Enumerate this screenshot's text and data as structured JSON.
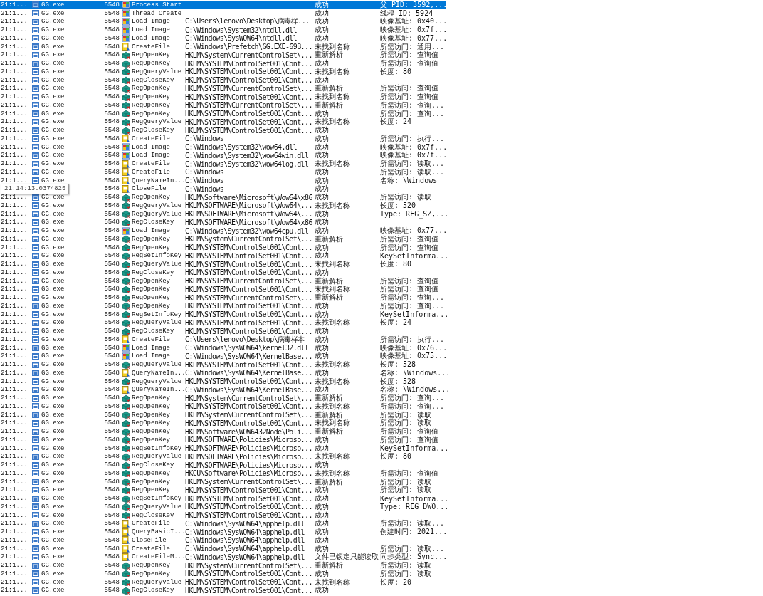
{
  "rows": [
    {
      "time": "21:1...",
      "process": "GG.exe",
      "pid": "5548",
      "kind": "process",
      "operation": "Process Start",
      "result": "成功",
      "detail": "父 PID: 3592,...",
      "selected": true
    },
    {
      "time": "21:1...",
      "process": "GG.exe",
      "pid": "5548",
      "kind": "process",
      "operation": "Thread Create",
      "result": "成功",
      "detail": "线程 ID: 5924",
      "selected": false
    },
    {
      "time": "21:1...",
      "process": "GG.exe",
      "pid": "5548",
      "kind": "process",
      "operation": "Load Image",
      "path": "C:\\Users\\lenovo\\Desktop\\病毒样...",
      "result": "成功",
      "detail": "映像基址: 0x40...",
      "selected": false
    },
    {
      "time": "21:1...",
      "process": "GG.exe",
      "pid": "5548",
      "kind": "process",
      "operation": "Load Image",
      "path": "C:\\Windows\\System32\\ntdll.dll",
      "result": "成功",
      "detail": "映像基址: 0x7f...",
      "selected": false
    },
    {
      "time": "21:1...",
      "process": "GG.exe",
      "pid": "5548",
      "kind": "process",
      "operation": "Load Image",
      "path": "C:\\Windows\\SysWOW64\\ntdll.dll",
      "result": "成功",
      "detail": "映像基址: 0x77...",
      "selected": false
    },
    {
      "time": "21:1...",
      "process": "GG.exe",
      "pid": "5548",
      "kind": "file",
      "operation": "CreateFile",
      "path": "C:\\Windows\\Prefetch\\GG.EXE-69B...",
      "result": "未找到名称",
      "detail": "所需访问: 通用...",
      "selected": false
    },
    {
      "time": "21:1...",
      "process": "GG.exe",
      "pid": "5548",
      "kind": "registry",
      "operation": "RegOpenKey",
      "path": "HKLM\\System\\CurrentControlSet\\...",
      "result": "重新解析",
      "detail": "所需访问: 查询值",
      "selected": false
    },
    {
      "time": "21:1...",
      "process": "GG.exe",
      "pid": "5548",
      "kind": "registry",
      "operation": "RegOpenKey",
      "path": "HKLM\\SYSTEM\\ControlSet001\\Cont...",
      "result": "成功",
      "detail": "所需访问: 查询值",
      "selected": false
    },
    {
      "time": "21:1...",
      "process": "GG.exe",
      "pid": "5548",
      "kind": "registry",
      "operation": "RegQueryValue",
      "path": "HKLM\\SYSTEM\\ControlSet001\\Cont...",
      "result": "未找到名称",
      "detail": "长度: 80",
      "selected": false
    },
    {
      "time": "21:1...",
      "process": "GG.exe",
      "pid": "5548",
      "kind": "registry",
      "operation": "RegCloseKey",
      "path": "HKLM\\SYSTEM\\ControlSet001\\Cont...",
      "result": "成功",
      "selected": false
    },
    {
      "time": "21:1...",
      "process": "GG.exe",
      "pid": "5548",
      "kind": "registry",
      "operation": "RegOpenKey",
      "path": "HKLM\\SYSTEM\\CurrentControlSet\\...",
      "result": "重新解析",
      "detail": "所需访问: 查询值",
      "selected": false
    },
    {
      "time": "21:1...",
      "process": "GG.exe",
      "pid": "5548",
      "kind": "registry",
      "operation": "RegOpenKey",
      "path": "HKLM\\SYSTEM\\ControlSet001\\Cont...",
      "result": "未找到名称",
      "detail": "所需访问: 查询值",
      "selected": false
    },
    {
      "time": "21:1...",
      "process": "GG.exe",
      "pid": "5548",
      "kind": "registry",
      "operation": "RegOpenKey",
      "path": "HKLM\\SYSTEM\\CurrentControlSet\\...",
      "result": "重新解析",
      "detail": "所需访问: 查询...",
      "selected": false
    },
    {
      "time": "21:1...",
      "process": "GG.exe",
      "pid": "5548",
      "kind": "registry",
      "operation": "RegOpenKey",
      "path": "HKLM\\SYSTEM\\ControlSet001\\Cont...",
      "result": "成功",
      "detail": "所需访问: 查询...",
      "selected": false
    },
    {
      "time": "21:1...",
      "process": "GG.exe",
      "pid": "5548",
      "kind": "registry",
      "operation": "RegQueryValue",
      "path": "HKLM\\SYSTEM\\ControlSet001\\Cont...",
      "result": "未找到名称",
      "detail": "长度: 24",
      "selected": false
    },
    {
      "time": "21:1...",
      "process": "GG.exe",
      "pid": "5548",
      "kind": "registry",
      "operation": "RegCloseKey",
      "path": "HKLM\\SYSTEM\\ControlSet001\\Cont...",
      "result": "成功",
      "selected": false
    },
    {
      "time": "21:1...",
      "process": "GG.exe",
      "pid": "5548",
      "kind": "file",
      "operation": "CreateFile",
      "path": "C:\\Windows",
      "result": "成功",
      "detail": "所需访问: 执行...",
      "selected": false
    },
    {
      "time": "21:1...",
      "process": "GG.exe",
      "pid": "5548",
      "kind": "process",
      "operation": "Load Image",
      "path": "C:\\Windows\\System32\\wow64.dll",
      "result": "成功",
      "detail": "映像基址: 0x7f...",
      "selected": false
    },
    {
      "time": "21:1...",
      "process": "GG.exe",
      "pid": "5548",
      "kind": "process",
      "operation": "Load Image",
      "path": "C:\\Windows\\System32\\wow64win.dll",
      "result": "成功",
      "detail": "映像基址: 0x7f...",
      "selected": false
    },
    {
      "time": "21:1...",
      "process": "GG.exe",
      "pid": "5548",
      "kind": "file",
      "operation": "CreateFile",
      "path": "C:\\Windows\\System32\\wow64log.dll",
      "result": "未找到名称",
      "detail": "所需访问: 读取...",
      "selected": false
    },
    {
      "time": "21:1...",
      "process": "GG.exe",
      "pid": "5548",
      "kind": "file",
      "operation": "CreateFile",
      "path": "C:\\Windows",
      "result": "成功",
      "detail": "所需访问: 读取...",
      "selected": false
    },
    {
      "time": "21:1...",
      "process": "GG.exe",
      "pid": "5548",
      "kind": "file",
      "operation": "QueryNameIn...",
      "path": "C:\\Windows",
      "result": "成功",
      "detail": "名称: \\Windows",
      "selected": false
    },
    {
      "pid": "5548",
      "kind": "file",
      "operation": "CloseFile",
      "path": "C:\\Windows",
      "result": "成功",
      "tooltip": "21:14:13.0374825",
      "selected": false
    },
    {
      "time": "21:1...",
      "process": "GG.exe",
      "pid": "5548",
      "kind": "registry",
      "operation": "RegOpenKey",
      "path": "HKLM\\Software\\Microsoft\\Wow64\\x86",
      "result": "成功",
      "detail": "所需访问: 读取",
      "selected": false
    },
    {
      "time": "21:1...",
      "process": "GG.exe",
      "pid": "5548",
      "kind": "registry",
      "operation": "RegQueryValue",
      "path": "HKLM\\SOFTWARE\\Microsoft\\Wow64\\...",
      "result": "未找到名称",
      "detail": "长度: 520",
      "selected": false
    },
    {
      "time": "21:1...",
      "process": "GG.exe",
      "pid": "5548",
      "kind": "registry",
      "operation": "RegQueryValue",
      "path": "HKLM\\SOFTWARE\\Microsoft\\Wow64\\...",
      "result": "成功",
      "detail": "Type: REG_SZ,...",
      "selected": false
    },
    {
      "time": "21:1...",
      "process": "GG.exe",
      "pid": "5548",
      "kind": "registry",
      "operation": "RegCloseKey",
      "path": "HKLM\\SOFTWARE\\Microsoft\\Wow64\\x86",
      "result": "成功",
      "selected": false
    },
    {
      "time": "21:1...",
      "process": "GG.exe",
      "pid": "5548",
      "kind": "process",
      "operation": "Load Image",
      "path": "C:\\Windows\\System32\\wow64cpu.dll",
      "result": "成功",
      "detail": "映像基址: 0x77...",
      "selected": false
    },
    {
      "time": "21:1...",
      "process": "GG.exe",
      "pid": "5548",
      "kind": "registry",
      "operation": "RegOpenKey",
      "path": "HKLM\\System\\CurrentControlSet\\...",
      "result": "重新解析",
      "detail": "所需访问: 查询值",
      "selected": false
    },
    {
      "time": "21:1...",
      "process": "GG.exe",
      "pid": "5548",
      "kind": "registry",
      "operation": "RegOpenKey",
      "path": "HKLM\\SYSTEM\\ControlSet001\\Cont...",
      "result": "成功",
      "detail": "所需访问: 查询值",
      "selected": false
    },
    {
      "time": "21:1...",
      "process": "GG.exe",
      "pid": "5548",
      "kind": "registry",
      "operation": "RegSetInfoKey",
      "path": "HKLM\\SYSTEM\\ControlSet001\\Cont...",
      "result": "成功",
      "detail": "KeySetInforma...",
      "selected": false
    },
    {
      "time": "21:1...",
      "process": "GG.exe",
      "pid": "5548",
      "kind": "registry",
      "operation": "RegQueryValue",
      "path": "HKLM\\SYSTEM\\ControlSet001\\Cont...",
      "result": "未找到名称",
      "detail": "长度: 80",
      "selected": false
    },
    {
      "time": "21:1...",
      "process": "GG.exe",
      "pid": "5548",
      "kind": "registry",
      "operation": "RegCloseKey",
      "path": "HKLM\\SYSTEM\\ControlSet001\\Cont...",
      "result": "成功",
      "selected": false
    },
    {
      "time": "21:1...",
      "process": "GG.exe",
      "pid": "5548",
      "kind": "registry",
      "operation": "RegOpenKey",
      "path": "HKLM\\SYSTEM\\CurrentControlSet\\...",
      "result": "重新解析",
      "detail": "所需访问: 查询值",
      "selected": false
    },
    {
      "time": "21:1...",
      "process": "GG.exe",
      "pid": "5548",
      "kind": "registry",
      "operation": "RegOpenKey",
      "path": "HKLM\\SYSTEM\\ControlSet001\\Cont...",
      "result": "未找到名称",
      "detail": "所需访问: 查询值",
      "selected": false
    },
    {
      "time": "21:1...",
      "process": "GG.exe",
      "pid": "5548",
      "kind": "registry",
      "operation": "RegOpenKey",
      "path": "HKLM\\SYSTEM\\CurrentControlSet\\...",
      "result": "重新解析",
      "detail": "所需访问: 查询...",
      "selected": false
    },
    {
      "time": "21:1...",
      "process": "GG.exe",
      "pid": "5548",
      "kind": "registry",
      "operation": "RegOpenKey",
      "path": "HKLM\\SYSTEM\\ControlSet001\\Cont...",
      "result": "成功",
      "detail": "所需访问: 查询...",
      "selected": false
    },
    {
      "time": "21:1...",
      "process": "GG.exe",
      "pid": "5548",
      "kind": "registry",
      "operation": "RegSetInfoKey",
      "path": "HKLM\\SYSTEM\\ControlSet001\\Cont...",
      "result": "成功",
      "detail": "KeySetInforma...",
      "selected": false
    },
    {
      "time": "21:1...",
      "process": "GG.exe",
      "pid": "5548",
      "kind": "registry",
      "operation": "RegQueryValue",
      "path": "HKLM\\SYSTEM\\ControlSet001\\Cont...",
      "result": "未找到名称",
      "detail": "长度: 24",
      "selected": false
    },
    {
      "time": "21:1...",
      "process": "GG.exe",
      "pid": "5548",
      "kind": "registry",
      "operation": "RegCloseKey",
      "path": "HKLM\\SYSTEM\\ControlSet001\\Cont...",
      "result": "成功",
      "selected": false
    },
    {
      "time": "21:1...",
      "process": "GG.exe",
      "pid": "5548",
      "kind": "file",
      "operation": "CreateFile",
      "path": "C:\\Users\\lenovo\\Desktop\\病毒样本",
      "result": "成功",
      "detail": "所需访问: 执行...",
      "selected": false
    },
    {
      "time": "21:1...",
      "process": "GG.exe",
      "pid": "5548",
      "kind": "process",
      "operation": "Load Image",
      "path": "C:\\Windows\\SysWOW64\\kernel32.dll",
      "result": "成功",
      "detail": "映像基址: 0x76...",
      "selected": false
    },
    {
      "time": "21:1...",
      "process": "GG.exe",
      "pid": "5548",
      "kind": "process",
      "operation": "Load Image",
      "path": "C:\\Windows\\SysWOW64\\KernelBase...",
      "result": "成功",
      "detail": "映像基址: 0x75...",
      "selected": false
    },
    {
      "time": "21:1...",
      "process": "GG.exe",
      "pid": "5548",
      "kind": "registry",
      "operation": "RegQueryValue",
      "path": "HKLM\\SYSTEM\\ControlSet001\\Cont...",
      "result": "未找到名称",
      "detail": "长度: 528",
      "selected": false
    },
    {
      "time": "21:1...",
      "process": "GG.exe",
      "pid": "5548",
      "kind": "file",
      "operation": "QueryNameIn...",
      "path": "C:\\Windows\\SysWOW64\\KernelBase...",
      "result": "成功",
      "detail": "名称: \\Windows...",
      "selected": false
    },
    {
      "time": "21:1...",
      "process": "GG.exe",
      "pid": "5548",
      "kind": "registry",
      "operation": "RegQueryValue",
      "path": "HKLM\\SYSTEM\\ControlSet001\\Cont...",
      "result": "未找到名称",
      "detail": "长度: 528",
      "selected": false
    },
    {
      "time": "21:1...",
      "process": "GG.exe",
      "pid": "5548",
      "kind": "file",
      "operation": "QueryNameIn...",
      "path": "C:\\Windows\\SysWOW64\\KernelBase...",
      "result": "成功",
      "detail": "名称: \\Windows...",
      "selected": false
    },
    {
      "time": "21:1...",
      "process": "GG.exe",
      "pid": "5548",
      "kind": "registry",
      "operation": "RegOpenKey",
      "path": "HKLM\\System\\CurrentControlSet\\...",
      "result": "重新解析",
      "detail": "所需访问: 查询...",
      "selected": false
    },
    {
      "time": "21:1...",
      "process": "GG.exe",
      "pid": "5548",
      "kind": "registry",
      "operation": "RegOpenKey",
      "path": "HKLM\\SYSTEM\\ControlSet001\\Cont...",
      "result": "未找到名称",
      "detail": "所需访问: 查询...",
      "selected": false
    },
    {
      "time": "21:1...",
      "process": "GG.exe",
      "pid": "5548",
      "kind": "registry",
      "operation": "RegOpenKey",
      "path": "HKLM\\System\\CurrentControlSet\\...",
      "result": "重新解析",
      "detail": "所需访问: 读取",
      "selected": false
    },
    {
      "time": "21:1...",
      "process": "GG.exe",
      "pid": "5548",
      "kind": "registry",
      "operation": "RegOpenKey",
      "path": "HKLM\\SYSTEM\\ControlSet001\\Cont...",
      "result": "未找到名称",
      "detail": "所需访问: 读取",
      "selected": false
    },
    {
      "time": "21:1...",
      "process": "GG.exe",
      "pid": "5548",
      "kind": "registry",
      "operation": "RegOpenKey",
      "path": "HKLM\\Software\\WOW6432Node\\Poli...",
      "result": "重新解析",
      "detail": "所需访问: 查询值",
      "selected": false
    },
    {
      "time": "21:1...",
      "process": "GG.exe",
      "pid": "5548",
      "kind": "registry",
      "operation": "RegOpenKey",
      "path": "HKLM\\SOFTWARE\\Policies\\Microso...",
      "result": "成功",
      "detail": "所需访问: 查询值",
      "selected": false
    },
    {
      "time": "21:1...",
      "process": "GG.exe",
      "pid": "5548",
      "kind": "registry",
      "operation": "RegSetInfoKey",
      "path": "HKLM\\SOFTWARE\\Policies\\Microso...",
      "result": "成功",
      "detail": "KeySetInforma...",
      "selected": false
    },
    {
      "time": "21:1...",
      "process": "GG.exe",
      "pid": "5548",
      "kind": "registry",
      "operation": "RegQueryValue",
      "path": "HKLM\\SOFTWARE\\Policies\\Microso...",
      "result": "未找到名称",
      "detail": "长度: 80",
      "selected": false
    },
    {
      "time": "21:1...",
      "process": "GG.exe",
      "pid": "5548",
      "kind": "registry",
      "operation": "RegCloseKey",
      "path": "HKLM\\SOFTWARE\\Policies\\Microso...",
      "result": "成功",
      "selected": false
    },
    {
      "time": "21:1...",
      "process": "GG.exe",
      "pid": "5548",
      "kind": "registry",
      "operation": "RegOpenKey",
      "path": "HKCU\\Software\\Policies\\Microso...",
      "result": "未找到名称",
      "detail": "所需访问: 查询值",
      "selected": false
    },
    {
      "time": "21:1...",
      "process": "GG.exe",
      "pid": "5548",
      "kind": "registry",
      "operation": "RegOpenKey",
      "path": "HKLM\\System\\CurrentControlSet\\...",
      "result": "重新解析",
      "detail": "所需访问: 读取",
      "selected": false
    },
    {
      "time": "21:1...",
      "process": "GG.exe",
      "pid": "5548",
      "kind": "registry",
      "operation": "RegOpenKey",
      "path": "HKLM\\SYSTEM\\ControlSet001\\Cont...",
      "result": "成功",
      "detail": "所需访问: 读取",
      "selected": false
    },
    {
      "time": "21:1...",
      "process": "GG.exe",
      "pid": "5548",
      "kind": "registry",
      "operation": "RegSetInfoKey",
      "path": "HKLM\\SYSTEM\\ControlSet001\\Cont...",
      "result": "成功",
      "detail": "KeySetInforma...",
      "selected": false
    },
    {
      "time": "21:1...",
      "process": "GG.exe",
      "pid": "5548",
      "kind": "registry",
      "operation": "RegQueryValue",
      "path": "HKLM\\SYSTEM\\ControlSet001\\Cont...",
      "result": "成功",
      "detail": "Type: REG_DWO...",
      "selected": false
    },
    {
      "time": "21:1...",
      "process": "GG.exe",
      "pid": "5548",
      "kind": "registry",
      "operation": "RegCloseKey",
      "path": "HKLM\\SYSTEM\\ControlSet001\\Cont...",
      "result": "成功",
      "selected": false
    },
    {
      "time": "21:1...",
      "process": "GG.exe",
      "pid": "5548",
      "kind": "file",
      "operation": "CreateFile",
      "path": "C:\\Windows\\SysWOW64\\apphelp.dll",
      "result": "成功",
      "detail": "所需访问: 读取...",
      "selected": false
    },
    {
      "time": "21:1...",
      "process": "GG.exe",
      "pid": "5548",
      "kind": "file",
      "operation": "QueryBasicI...",
      "path": "C:\\Windows\\SysWOW64\\apphelp.dll",
      "result": "成功",
      "detail": "创建时间: 2021...",
      "selected": false
    },
    {
      "time": "21:1...",
      "process": "GG.exe",
      "pid": "5548",
      "kind": "file",
      "operation": "CloseFile",
      "path": "C:\\Windows\\SysWOW64\\apphelp.dll",
      "result": "成功",
      "selected": false
    },
    {
      "time": "21:1...",
      "process": "GG.exe",
      "pid": "5548",
      "kind": "file",
      "operation": "CreateFile",
      "path": "C:\\Windows\\SysWOW64\\apphelp.dll",
      "result": "成功",
      "detail": "所需访问: 读取...",
      "selected": false
    },
    {
      "time": "21:1...",
      "process": "GG.exe",
      "pid": "5548",
      "kind": "file",
      "operation": "CreateFileM...",
      "path": "C:\\Windows\\SysWOW64\\apphelp.dll",
      "result": "文件已锁定只能读取",
      "detail": "同步类型: Sync...",
      "selected": false
    },
    {
      "time": "21:1...",
      "process": "GG.exe",
      "pid": "5548",
      "kind": "registry",
      "operation": "RegOpenKey",
      "path": "HKLM\\System\\CurrentControlSet\\...",
      "result": "重新解析",
      "detail": "所需访问: 读取",
      "selected": false
    },
    {
      "time": "21:1...",
      "process": "GG.exe",
      "pid": "5548",
      "kind": "registry",
      "operation": "RegOpenKey",
      "path": "HKLM\\SYSTEM\\ControlSet001\\Cont...",
      "result": "成功",
      "detail": "所需访问: 读取",
      "selected": false
    },
    {
      "time": "21:1...",
      "process": "GG.exe",
      "pid": "5548",
      "kind": "registry",
      "operation": "RegQueryValue",
      "path": "HKLM\\SYSTEM\\ControlSet001\\Cont...",
      "result": "未找到名称",
      "detail": "长度: 20",
      "selected": false
    },
    {
      "time": "21:1...",
      "process": "GG.exe",
      "pid": "5548",
      "kind": "registry",
      "operation": "RegCloseKey",
      "path": "HKLM\\SYSTEM\\ControlSet001\\Cont...",
      "result": "成功",
      "selected": false
    }
  ]
}
